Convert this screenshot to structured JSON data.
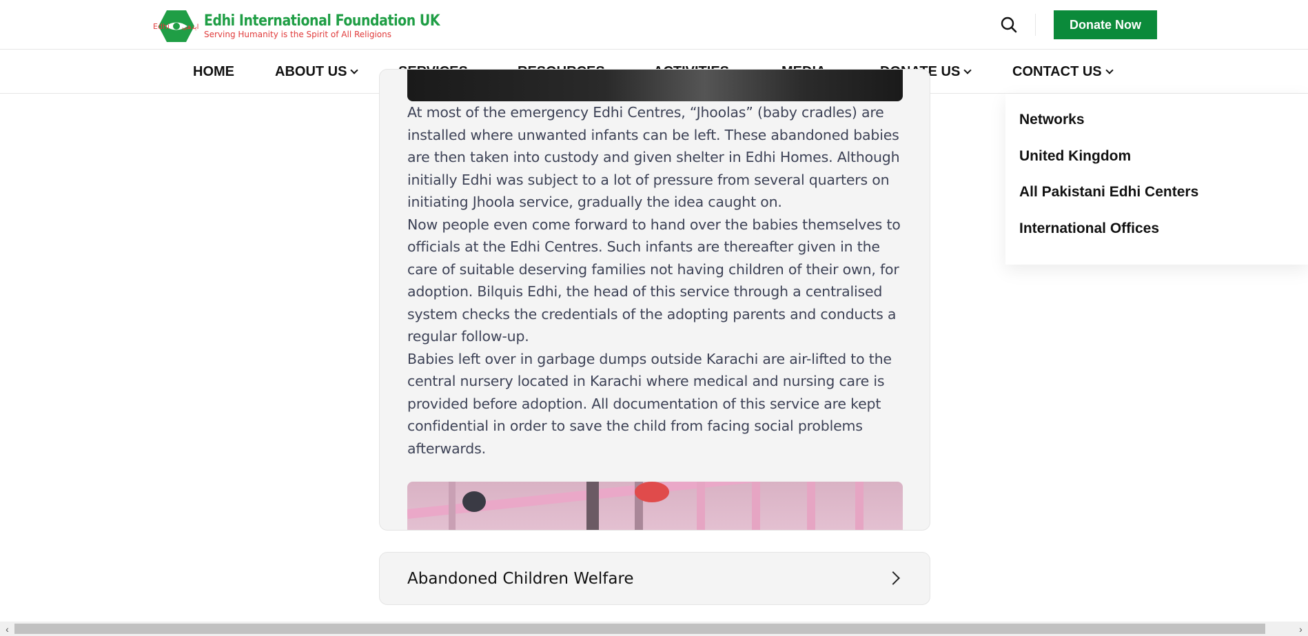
{
  "header": {
    "logo_title": "Edhi International Foundation UK",
    "logo_subtitle": "Serving Humanity is the Spirit of All Religions",
    "logo_mark_text": "Edhi",
    "logo_mark_text_urdu": "ایدھی",
    "search_icon": "search-icon",
    "donate_button": "Donate Now",
    "brand_green": "#0b8a3a",
    "brand_red": "#e03a3a"
  },
  "nav": {
    "items": [
      {
        "label": "HOME",
        "has_dropdown": false
      },
      {
        "label": "ABOUT US",
        "has_dropdown": true
      },
      {
        "label": "SERVICES",
        "has_dropdown": true
      },
      {
        "label": "RESOURCES",
        "has_dropdown": true
      },
      {
        "label": "ACTIVITIES",
        "has_dropdown": true
      },
      {
        "label": "MEDIA",
        "has_dropdown": true
      },
      {
        "label": "DONATE US",
        "has_dropdown": true
      },
      {
        "label": "CONTACT US",
        "has_dropdown": true
      }
    ]
  },
  "dropdown": {
    "parent": "CONTACT US",
    "items": [
      "Networks",
      "United Kingdom",
      "All Pakistani Edhi Centers",
      "International Offices"
    ]
  },
  "article": {
    "paragraphs": [
      "At most of the emergency Edhi Centres, “Jhoolas” (baby cradles) are installed where unwanted infants can be left. These abandoned babies are then taken into custody and given shelter in Edhi Homes. Although initially Edhi was subject to a lot of pressure from several quarters on initiating Jhoola service, gradually the idea caught on.",
      "Now people even come forward to hand over the babies themselves to officials at the Edhi Centres. Such infants are thereafter given in the care of suitable deserving families not having children of their own, for adoption. Bilquis Edhi, the head of this service through a centralised system checks the credentials of the adopting parents and conducts a regular follow-up.",
      "Babies left over in garbage dumps outside Karachi are air-lifted to the central nursery located in Karachi where medical and nursing care is provided before adoption. All documentation of this service are kept confidential in order to save the child from facing social problems afterwards."
    ]
  },
  "accordion": {
    "title": "Abandoned Children Welfare",
    "icon": "chevron-right-icon"
  },
  "scrollbar": {
    "left_arrow": "‹",
    "right_arrow": "›"
  }
}
